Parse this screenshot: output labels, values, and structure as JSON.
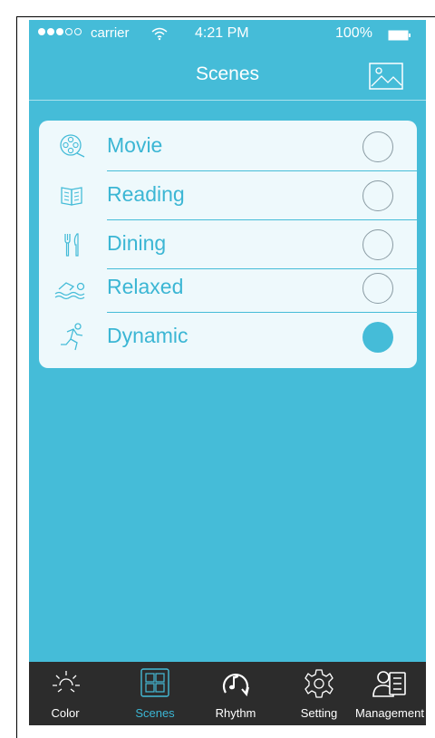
{
  "colors": {
    "accent": "#45bcd8",
    "card": "#eef9fc",
    "tabbar": "#2c2c2c"
  },
  "status_bar": {
    "carrier": "carrier",
    "time": "4:21 PM",
    "battery": "100%"
  },
  "navbar": {
    "title": "Scenes",
    "right_icon": "image-icon"
  },
  "scenes": [
    {
      "label": "Movie",
      "icon": "film-reel-icon",
      "selected": false
    },
    {
      "label": "Reading",
      "icon": "book-icon",
      "selected": false
    },
    {
      "label": "Dining",
      "icon": "fork-knife-icon",
      "selected": false
    },
    {
      "label": "Relaxed",
      "icon": "swimmer-icon",
      "selected": false
    },
    {
      "label": "Dynamic",
      "icon": "runner-icon",
      "selected": true
    }
  ],
  "tabs": [
    {
      "label": "Color",
      "icon": "sun-icon",
      "active": false
    },
    {
      "label": "Scenes",
      "icon": "grid-icon",
      "active": true
    },
    {
      "label": "Rhythm",
      "icon": "music-note-icon",
      "active": false
    },
    {
      "label": "Setting",
      "icon": "gear-icon",
      "active": false
    },
    {
      "label": "Management",
      "icon": "contact-card-icon",
      "active": false
    }
  ]
}
